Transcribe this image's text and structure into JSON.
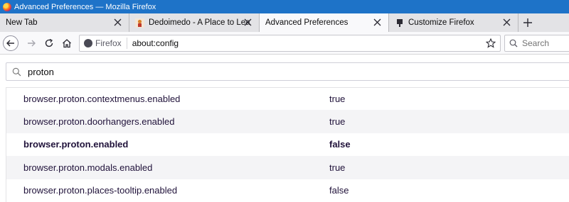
{
  "window": {
    "title": "Advanced Preferences — Mozilla Firefox"
  },
  "tabs": [
    {
      "label": "New Tab",
      "icon": "none",
      "active": false
    },
    {
      "label": "Dedoimedo - A Place to Learn",
      "icon": "dedoimedo-favicon",
      "active": false
    },
    {
      "label": "Advanced Preferences",
      "icon": "none",
      "active": true
    },
    {
      "label": "Customize Firefox",
      "icon": "puzzle-icon",
      "active": false
    }
  ],
  "navbar": {
    "identity_label": "Firefox",
    "url": "about:config",
    "search_placeholder": "Search"
  },
  "config": {
    "filter_value": "proton",
    "prefs": [
      {
        "name": "browser.proton.contextmenus.enabled",
        "value": "true",
        "modified": false
      },
      {
        "name": "browser.proton.doorhangers.enabled",
        "value": "true",
        "modified": false
      },
      {
        "name": "browser.proton.enabled",
        "value": "false",
        "modified": true
      },
      {
        "name": "browser.proton.modals.enabled",
        "value": "true",
        "modified": false
      },
      {
        "name": "browser.proton.places-tooltip.enabled",
        "value": "false",
        "modified": false
      }
    ]
  },
  "colors": {
    "titlebar": "#1e73c8",
    "tabstrip": "#e3e3e6",
    "active_tab": "#f9f9fb"
  }
}
